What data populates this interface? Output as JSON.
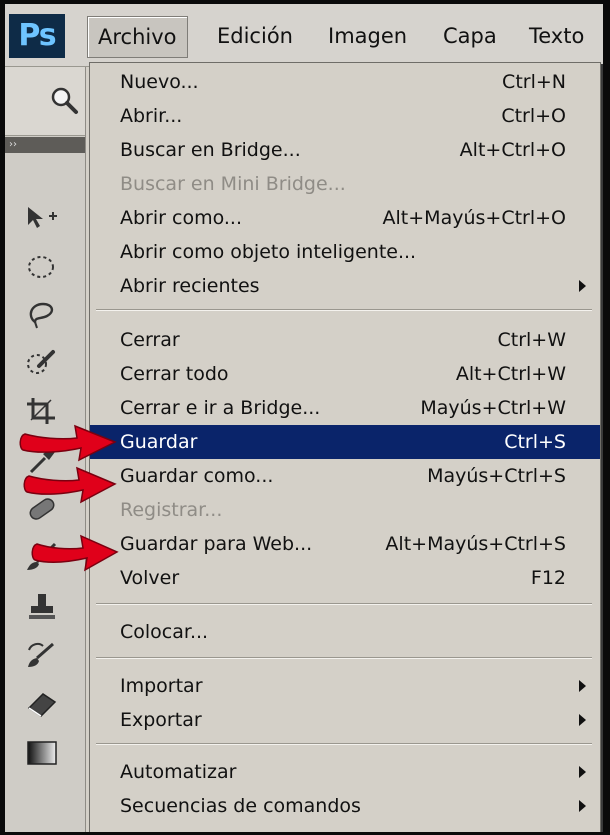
{
  "app": {
    "logo": "Ps"
  },
  "menubar": {
    "items": [
      {
        "label": "Archivo",
        "active": true
      },
      {
        "label": "Edición"
      },
      {
        "label": "Imagen"
      },
      {
        "label": "Capa"
      },
      {
        "label": "Texto"
      }
    ]
  },
  "archivo_menu": {
    "items": [
      {
        "label": "Nuevo...",
        "shortcut": "Ctrl+N"
      },
      {
        "label": "Abrir...",
        "shortcut": "Ctrl+O"
      },
      {
        "label": "Buscar en Bridge...",
        "shortcut": "Alt+Ctrl+O"
      },
      {
        "label": "Buscar en Mini Bridge...",
        "shortcut": "",
        "disabled": true
      },
      {
        "label": "Abrir como...",
        "shortcut": "Alt+Mayús+Ctrl+O"
      },
      {
        "label": "Abrir como objeto inteligente...",
        "shortcut": ""
      },
      {
        "label": "Abrir recientes",
        "shortcut": "",
        "submenu": true
      },
      {
        "label": "Cerrar",
        "shortcut": "Ctrl+W"
      },
      {
        "label": "Cerrar todo",
        "shortcut": "Alt+Ctrl+W"
      },
      {
        "label": "Cerrar e ir a Bridge...",
        "shortcut": "Mayús+Ctrl+W"
      },
      {
        "label": "Guardar",
        "shortcut": "Ctrl+S",
        "highlighted": true
      },
      {
        "label": "Guardar como...",
        "shortcut": "Mayús+Ctrl+S"
      },
      {
        "label": "Registrar...",
        "shortcut": "",
        "disabled": true
      },
      {
        "label": "Guardar para Web...",
        "shortcut": "Alt+Mayús+Ctrl+S"
      },
      {
        "label": "Volver",
        "shortcut": "F12"
      },
      {
        "label": "Colocar...",
        "shortcut": ""
      },
      {
        "label": "Importar",
        "shortcut": "",
        "submenu": true
      },
      {
        "label": "Exportar",
        "shortcut": "",
        "submenu": true
      },
      {
        "label": "Automatizar",
        "shortcut": "",
        "submenu": true
      },
      {
        "label": "Secuencias de comandos",
        "shortcut": "",
        "submenu": true
      }
    ]
  },
  "toolbar": {
    "tools": [
      {
        "icon": "move-tool-icon"
      },
      {
        "icon": "marquee-tool-icon"
      },
      {
        "icon": "lasso-tool-icon"
      },
      {
        "icon": "quick-selection-tool-icon"
      },
      {
        "icon": "crop-tool-icon"
      },
      {
        "icon": "eyedropper-tool-icon"
      },
      {
        "icon": "healing-brush-tool-icon"
      },
      {
        "icon": "brush-tool-icon"
      },
      {
        "icon": "clone-stamp-tool-icon"
      },
      {
        "icon": "history-brush-tool-icon"
      },
      {
        "icon": "eraser-tool-icon"
      },
      {
        "icon": "gradient-tool-icon"
      }
    ]
  },
  "colors": {
    "menu_bg": "#d4d0c8",
    "highlight": "#0a246a",
    "ps_logo_bg": "#0e2b47",
    "ps_logo_text": "#6ec4ff",
    "annotation_arrow": "#e0001a"
  }
}
